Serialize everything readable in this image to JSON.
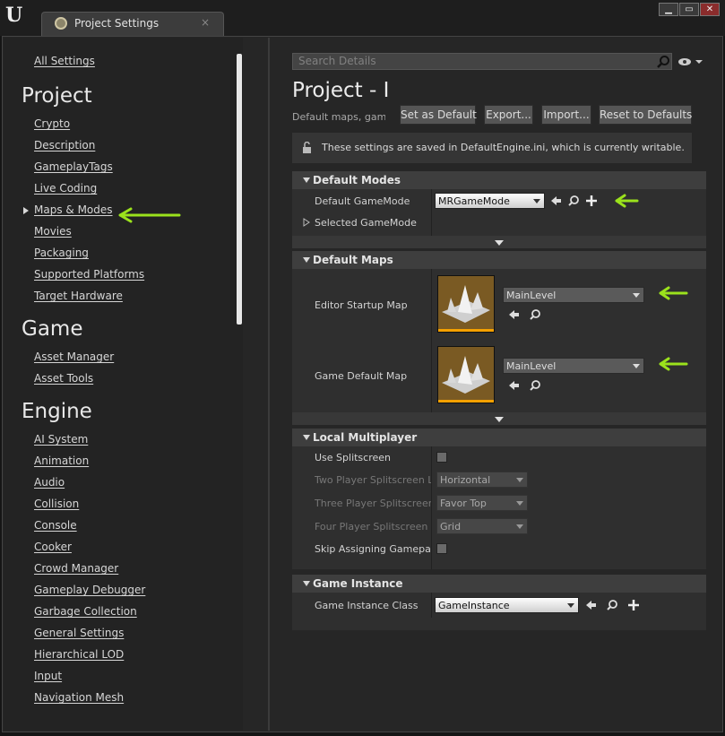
{
  "window": {
    "tab_title": "Project Settings",
    "tab_close": "×",
    "controls": [
      "▁",
      "▭",
      "✕"
    ]
  },
  "sidebar": {
    "all_settings": "All Settings",
    "groups": [
      {
        "heading": "Project",
        "items": [
          "Crypto",
          "Description",
          "GameplayTags",
          "Live Coding",
          "Maps & Modes",
          "Movies",
          "Packaging",
          "Supported Platforms",
          "Target Hardware"
        ]
      },
      {
        "heading": "Game",
        "items": [
          "Asset Manager",
          "Asset Tools"
        ]
      },
      {
        "heading": "Engine",
        "items": [
          "AI System",
          "Animation",
          "Audio",
          "Collision",
          "Console",
          "Cooker",
          "Crowd Manager",
          "Gameplay Debugger",
          "Garbage Collection",
          "General Settings",
          "Hierarchical LOD",
          "Input",
          "Navigation Mesh"
        ]
      }
    ],
    "selected_item": "Maps & Modes"
  },
  "details": {
    "search_placeholder": "Search Details",
    "page_title": "Project - I",
    "page_subtitle": "Default maps, game",
    "buttons": {
      "set_default": "Set as Default",
      "export": "Export...",
      "import": "Import...",
      "reset": "Reset to Defaults"
    },
    "notice": "These settings are saved in DefaultEngine.ini, which is currently writable."
  },
  "default_modes": {
    "title": "Default Modes",
    "default_gamemode_label": "Default GameMode",
    "default_gamemode_value": "MRGameMode",
    "selected_gamemode_label": "Selected GameMode"
  },
  "default_maps": {
    "title": "Default Maps",
    "editor_startup_label": "Editor Startup Map",
    "editor_startup_value": "MainLevel",
    "game_default_label": "Game Default Map",
    "game_default_value": "MainLevel"
  },
  "local_multiplayer": {
    "title": "Local Multiplayer",
    "use_splitscreen": "Use Splitscreen",
    "two_player_label": "Two Player Splitscreen La",
    "two_player_value": "Horizontal",
    "three_player_label": "Three Player Splitscreen L",
    "three_player_value": "Favor Top",
    "four_player_label": "Four Player Splitscreen La",
    "four_player_value": "Grid",
    "skip_gamepad_label": "Skip Assigning Gamepad t"
  },
  "game_instance": {
    "title": "Game Instance",
    "class_label": "Game Instance Class",
    "class_value": "GameInstance"
  },
  "colors": {
    "annotation_arrow": "#9be21c",
    "thumbnail_bar": "#f5a000"
  }
}
